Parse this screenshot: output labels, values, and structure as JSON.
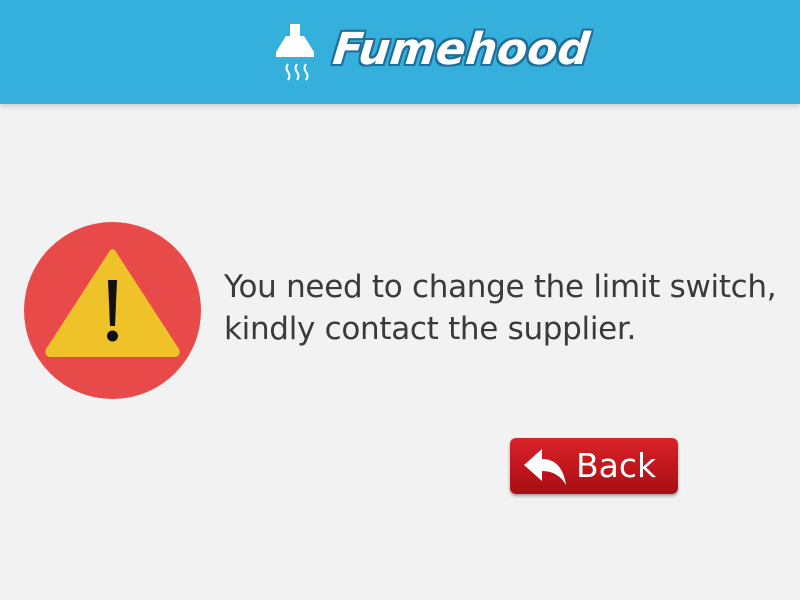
{
  "header": {
    "logo_text": "Fumehood",
    "logo_icon": "fume-hood-icon",
    "background_color": "#35b0dd"
  },
  "alert": {
    "icon": "warning-icon",
    "icon_circle_color": "#e84a4a",
    "icon_triangle_color": "#f0c229",
    "message_line1": "You need to change the limit switch,",
    "message_line2": "kindly contact the supplier."
  },
  "actions": {
    "back_label": "Back",
    "back_icon": "reply-arrow-icon",
    "back_color": "#c41a20"
  }
}
